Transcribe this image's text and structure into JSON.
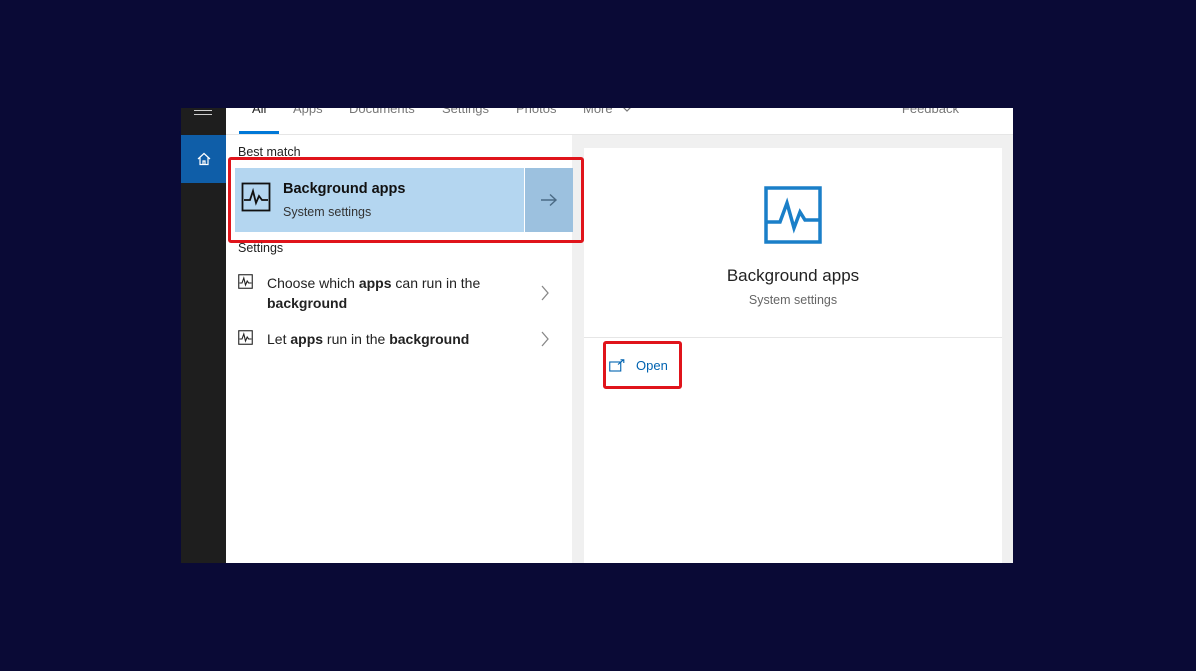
{
  "tabs": [
    {
      "label": "All"
    },
    {
      "label": "Apps"
    },
    {
      "label": "Documents"
    },
    {
      "label": "Settings"
    },
    {
      "label": "Photos"
    },
    {
      "label": "More"
    }
  ],
  "feedback_label": "Feedback",
  "sections": {
    "best_match": "Best match",
    "settings": "Settings"
  },
  "best_match": {
    "title": "Background apps",
    "subtitle": "System settings",
    "icon": "background-apps-icon"
  },
  "settings_results": [
    {
      "label_parts": [
        "Choose which ",
        "apps",
        " can run in the ",
        "background"
      ]
    },
    {
      "label_parts": [
        "Let ",
        "apps",
        " run in the ",
        "background"
      ]
    }
  ],
  "preview": {
    "title": "Background apps",
    "subtitle": "System settings",
    "open_label": "Open"
  },
  "colors": {
    "accent": "#0078d7",
    "selection": "#b4d6f0",
    "highlight": "#e0141b",
    "desktop": "#0a0a36"
  }
}
